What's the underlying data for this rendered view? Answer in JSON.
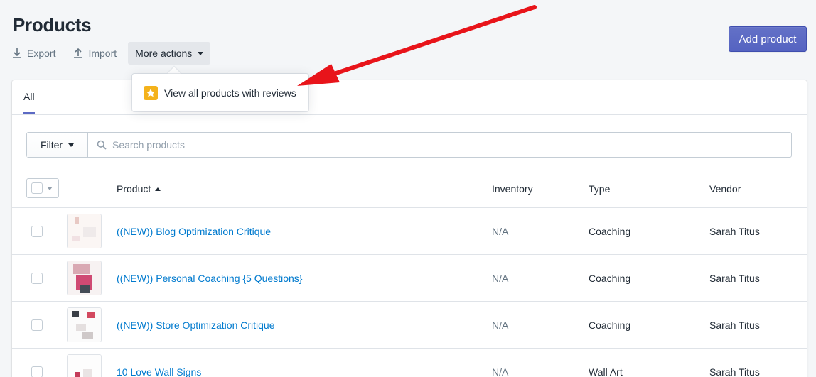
{
  "page": {
    "title": "Products",
    "export_label": "Export",
    "import_label": "Import",
    "more_actions_label": "More actions",
    "add_product_label": "Add product"
  },
  "popover": {
    "item_label": "View all products with reviews",
    "icon": "star-icon"
  },
  "tabs": [
    {
      "label": "All",
      "selected": true
    }
  ],
  "filter": {
    "button_label": "Filter",
    "search_placeholder": "Search products"
  },
  "table": {
    "columns": {
      "product": "Product",
      "inventory": "Inventory",
      "type": "Type",
      "vendor": "Vendor"
    },
    "sort_direction": "ascending",
    "rows": [
      {
        "name": "((NEW)) Blog Optimization Critique",
        "inventory": "N/A",
        "type": "Coaching",
        "vendor": "Sarah Titus"
      },
      {
        "name": "((NEW)) Personal Coaching {5 Questions}",
        "inventory": "N/A",
        "type": "Coaching",
        "vendor": "Sarah Titus"
      },
      {
        "name": "((NEW)) Store Optimization Critique",
        "inventory": "N/A",
        "type": "Coaching",
        "vendor": "Sarah Titus"
      },
      {
        "name": "10 Love Wall Signs",
        "inventory": "N/A",
        "type": "Wall Art",
        "vendor": "Sarah Titus"
      }
    ]
  },
  "colors": {
    "primary": "#5c6ac4",
    "link": "#007ace",
    "annotation_arrow": "#e8141a",
    "star_badge": "#f4b21b"
  }
}
